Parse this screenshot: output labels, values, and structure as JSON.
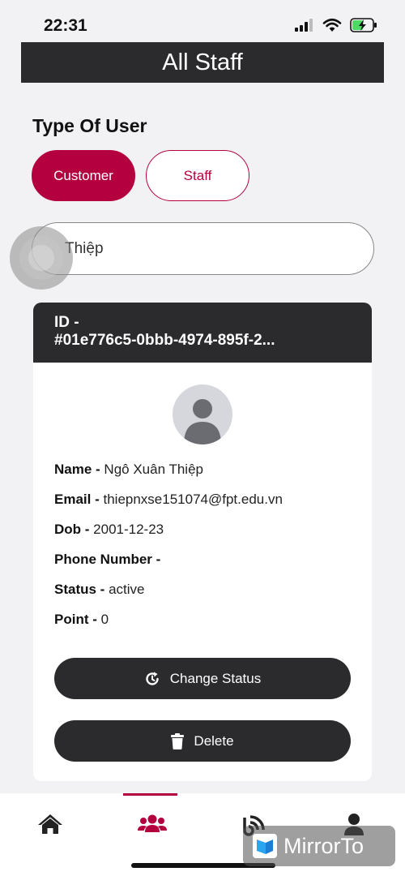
{
  "status_bar": {
    "time": "22:31"
  },
  "header": {
    "title": "All Staff"
  },
  "filter": {
    "label": "Type Of User",
    "options": [
      {
        "label": "Customer",
        "selected": true
      },
      {
        "label": "Staff",
        "selected": false
      }
    ]
  },
  "search": {
    "value": "Thiệp"
  },
  "user_card": {
    "id_label": "ID -",
    "id_value": "#01e776c5-0bbb-4974-895f-2...",
    "fields": [
      {
        "label": "Name -",
        "value": "Ngô Xuân Thiệp"
      },
      {
        "label": "Email -",
        "value": "thiepnxse151074@fpt.edu.vn"
      },
      {
        "label": "Dob -",
        "value": "2001-12-23"
      },
      {
        "label": "Phone Number -",
        "value": ""
      },
      {
        "label": "Status -",
        "value": "active"
      },
      {
        "label": "Point -",
        "value": "0"
      }
    ],
    "change_status_label": "Change Status",
    "delete_label": "Delete"
  },
  "tabbar": {
    "tabs": [
      {
        "icon": "home-icon",
        "active": false
      },
      {
        "icon": "users-icon",
        "active": true
      },
      {
        "icon": "feed-icon",
        "active": false
      },
      {
        "icon": "profile-icon",
        "active": false
      }
    ]
  },
  "watermark": {
    "text": "MirrorTo"
  },
  "colors": {
    "accent": "#b5003f",
    "dark": "#2b2a2d",
    "background": "#f2f2f4"
  }
}
